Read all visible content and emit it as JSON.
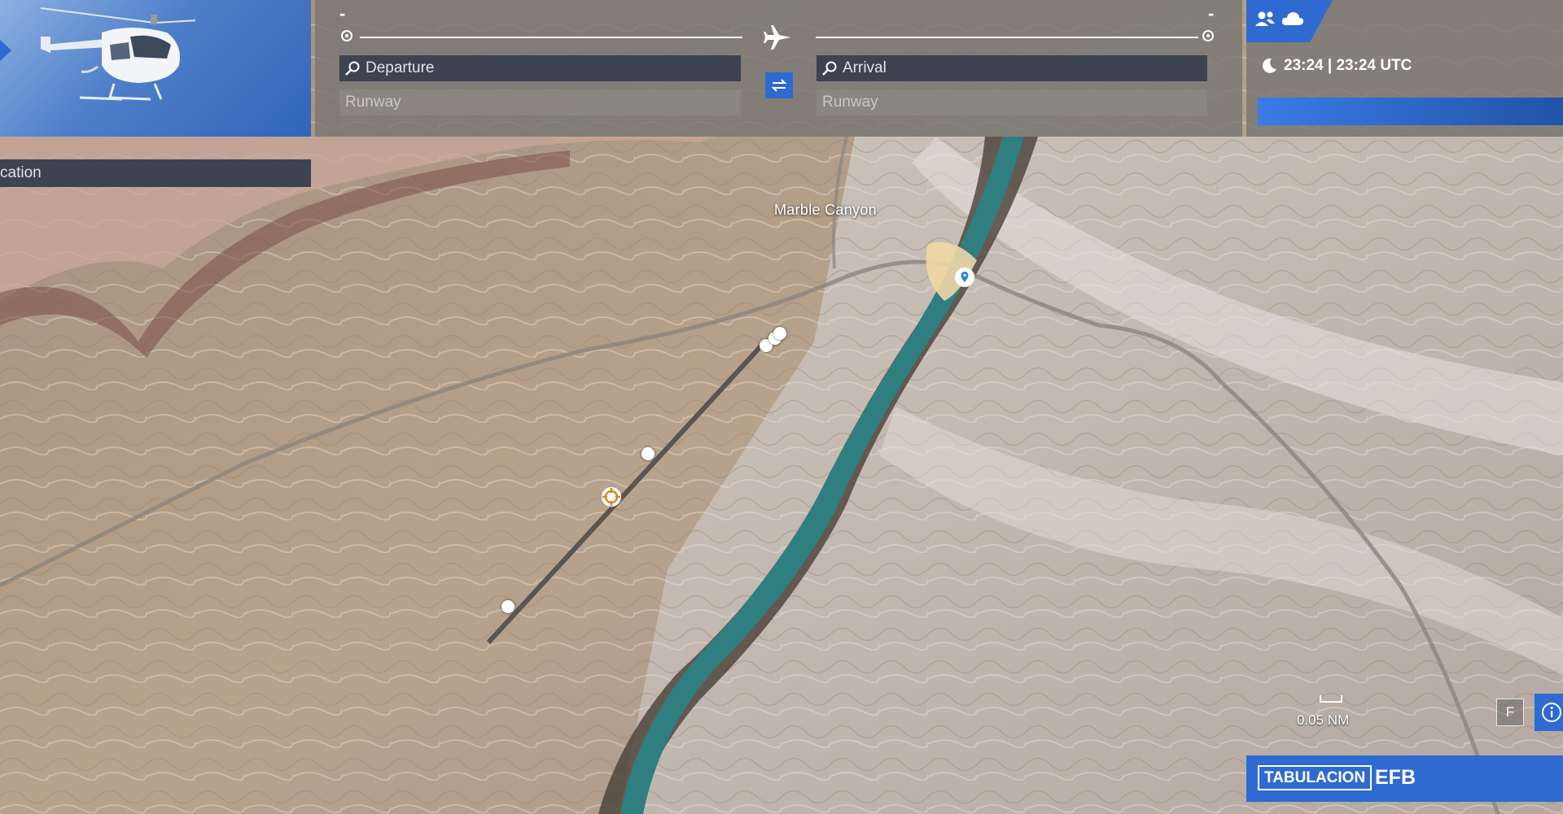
{
  "map": {
    "place_label": "Marble Canyon"
  },
  "flight_planner": {
    "departure_code": "-",
    "arrival_code": "-",
    "departure_placeholder": "Departure",
    "departure_runway": "Runway",
    "arrival_placeholder": "Arrival",
    "arrival_runway": "Runway",
    "icons": [
      "plane-icon",
      "swap-icon",
      "search-icon"
    ]
  },
  "status_panel": {
    "time_display": "23:24 |  23:24 UTC",
    "icons": [
      "multiplayer-icon",
      "weather-cloud-icon",
      "moon-icon"
    ]
  },
  "location_search": {
    "placeholder_fragment": "cation"
  },
  "map_controls": {
    "scale_label": "0.05 NM",
    "filter_button": "F",
    "info_icon": "info-icon"
  },
  "bottom_bar": {
    "tab_key": "TABULACION",
    "efb_label": "EFB"
  },
  "colors": {
    "accent_blue": "#2f6ad0",
    "field_dark": "#3d4351",
    "river": "#2f7f80",
    "terrain": "#b9aa98"
  }
}
